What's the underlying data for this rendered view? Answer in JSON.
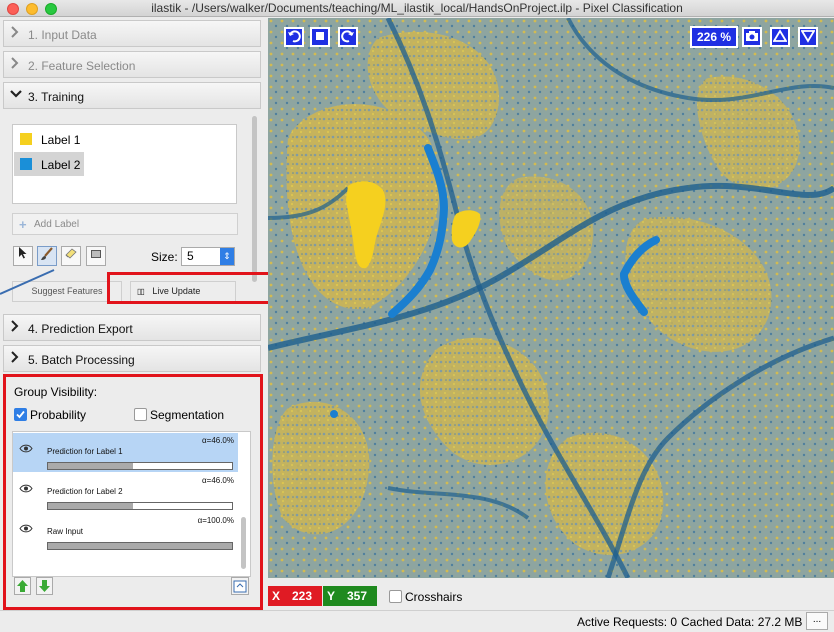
{
  "window": {
    "title": "ilastik - /Users/walker/Documents/teaching/ML_ilastik_local/HandsOnProject.ilp - Pixel Classification"
  },
  "applets": [
    {
      "label": "1. Input Data",
      "state": "collapsed",
      "icon": "chevron-right-icon"
    },
    {
      "label": "2. Feature Selection",
      "state": "collapsed",
      "icon": "chevron-right-icon"
    },
    {
      "label": "3. Training",
      "state": "expanded",
      "icon": "chevron-down-icon"
    },
    {
      "label": "4. Prediction Export",
      "state": "collapsed",
      "icon": "chevron-right-icon"
    },
    {
      "label": "5. Batch Processing",
      "state": "collapsed",
      "icon": "chevron-right-icon"
    }
  ],
  "training": {
    "labels": [
      {
        "name": "Label 1",
        "color": "#f5d01f"
      },
      {
        "name": "Label 2",
        "color": "#1a8fd8"
      }
    ],
    "add_label": "Add Label",
    "tools": [
      "pointer-icon",
      "brush-icon",
      "eraser-icon",
      "threshold-icon"
    ],
    "size_label": "Size:",
    "size_value": "5",
    "suggest_features": "Suggest Features",
    "live_update": "Live Update"
  },
  "group_visibility": {
    "title": "Group Visibility:",
    "probability_label": "Probability",
    "probability_checked": true,
    "segmentation_label": "Segmentation",
    "segmentation_checked": false
  },
  "layers": [
    {
      "name": "Prediction for Label 1",
      "opacity": "α=46.0%",
      "fraction": 0.46,
      "selected": true
    },
    {
      "name": "Prediction for Label 2",
      "opacity": "α=46.0%",
      "fraction": 0.46,
      "selected": false
    },
    {
      "name": "Raw Input",
      "opacity": "α=100.0%",
      "fraction": 1.0,
      "selected": false
    }
  ],
  "viewer": {
    "zoom": "226 %"
  },
  "coords": {
    "x_label": "X",
    "x_value": "223",
    "x_color": "#e01b24",
    "y_label": "Y",
    "y_value": "357",
    "y_color": "#1f8a1f",
    "crosshairs_label": "Crosshairs"
  },
  "status": {
    "active_requests": "Active Requests: 0",
    "cached_data": "Cached Data: 27.2 MB",
    "more": "..."
  },
  "colors": {
    "annotation_red": "#e1131b",
    "accent_blue": "#1f2fe3"
  }
}
